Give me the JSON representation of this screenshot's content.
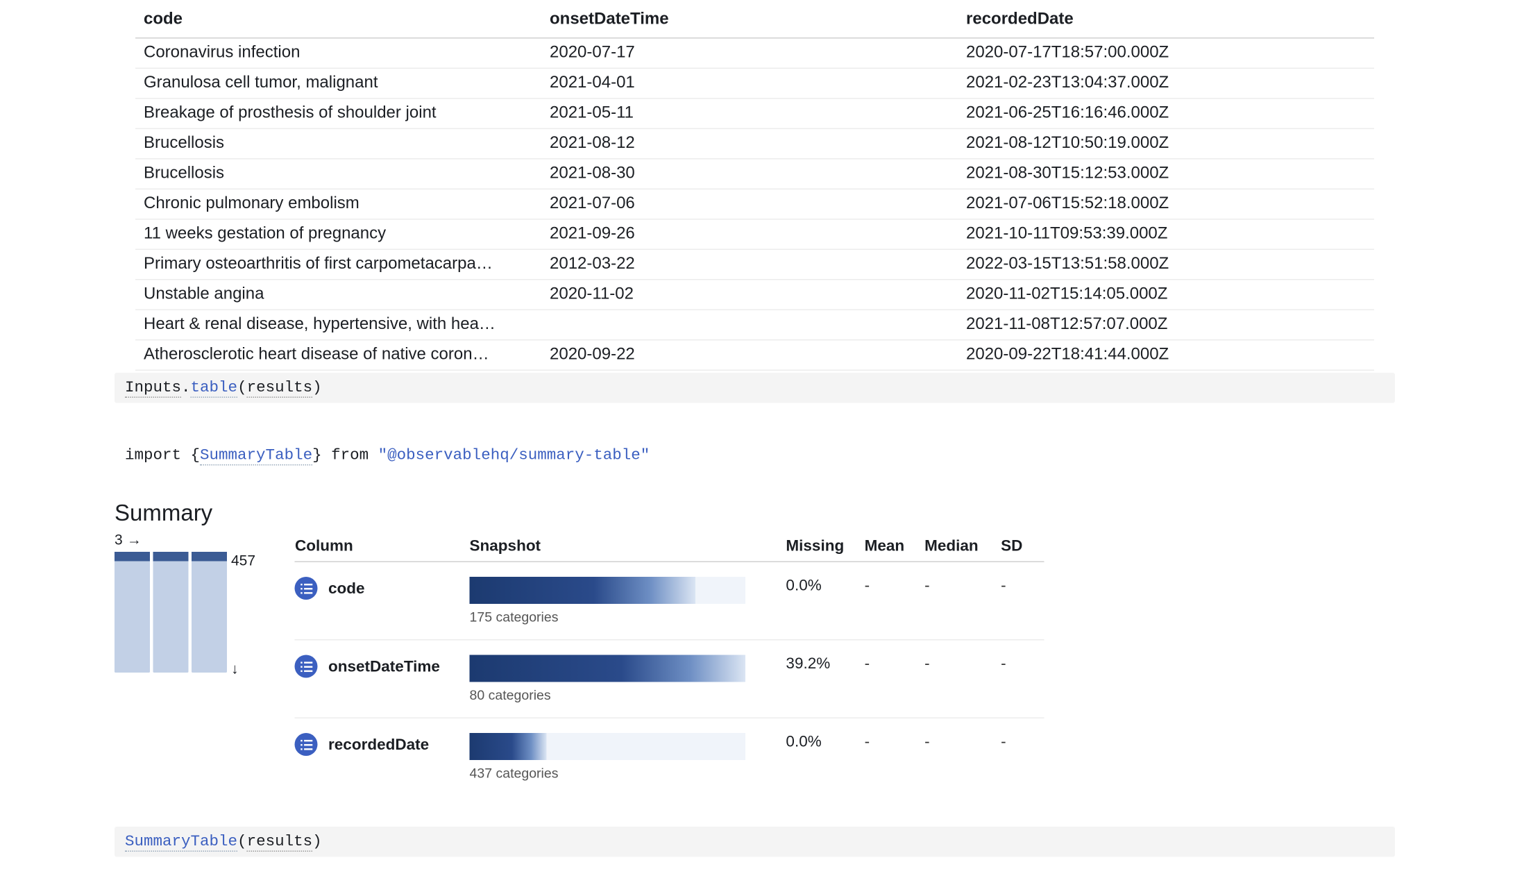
{
  "data_table": {
    "headers": [
      "code",
      "onsetDateTime",
      "recordedDate"
    ],
    "rows": [
      [
        "Coronavirus infection",
        "2020-07-17",
        "2020-07-17T18:57:00.000Z"
      ],
      [
        "Granulosa cell tumor, malignant",
        "2021-04-01",
        "2021-02-23T13:04:37.000Z"
      ],
      [
        "Breakage of prosthesis of shoulder joint",
        "2021-05-11",
        "2021-06-25T16:16:46.000Z"
      ],
      [
        "Brucellosis",
        "2021-08-12",
        "2021-08-12T10:50:19.000Z"
      ],
      [
        "Brucellosis",
        "2021-08-30",
        "2021-08-30T15:12:53.000Z"
      ],
      [
        "Chronic pulmonary embolism",
        "2021-07-06",
        "2021-07-06T15:52:18.000Z"
      ],
      [
        "11 weeks gestation of pregnancy",
        "2021-09-26",
        "2021-10-11T09:53:39.000Z"
      ],
      [
        "Primary osteoarthritis of first carpometacarpa…",
        "2012-03-22",
        "2022-03-15T13:51:58.000Z"
      ],
      [
        "Unstable angina",
        "2020-11-02",
        "2020-11-02T15:14:05.000Z"
      ],
      [
        "Heart & renal disease, hypertensive, with hea…",
        "",
        "2021-11-08T12:57:07.000Z"
      ],
      [
        "Atherosclerotic heart disease of native coron…",
        "2020-09-22",
        "2020-09-22T18:41:44.000Z"
      ]
    ]
  },
  "code_cell_1": {
    "object": "Inputs",
    "dot": ".",
    "method": "table",
    "paren_open": "(",
    "arg": "results",
    "paren_close": ")"
  },
  "import_cell": {
    "kw_import": "import",
    "brace_open": " {",
    "ident": "SummaryTable",
    "brace_close": "} ",
    "kw_from": "from",
    "space": " ",
    "module": "\"@observablehq/summary-table\""
  },
  "summary": {
    "heading": "Summary",
    "cols_count": "3",
    "rows_count": "457",
    "table_headers": [
      "Column",
      "Snapshot",
      "Missing",
      "Mean",
      "Median",
      "SD"
    ],
    "rows": [
      {
        "name": "code",
        "snapshot_note": "175 categories",
        "snapshot_fill_pct": 82,
        "missing": "0.0%",
        "mean": "-",
        "median": "-",
        "sd": "-"
      },
      {
        "name": "onsetDateTime",
        "snapshot_note": "80 categories",
        "snapshot_fill_pct": 100,
        "missing": "39.2%",
        "mean": "-",
        "median": "-",
        "sd": "-"
      },
      {
        "name": "recordedDate",
        "snapshot_note": "437 categories",
        "snapshot_fill_pct": 28,
        "missing": "0.0%",
        "mean": "-",
        "median": "-",
        "sd": "-"
      }
    ]
  },
  "code_cell_2": {
    "fn": "SummaryTable",
    "paren_open": "(",
    "arg": "results",
    "paren_close": ")"
  }
}
